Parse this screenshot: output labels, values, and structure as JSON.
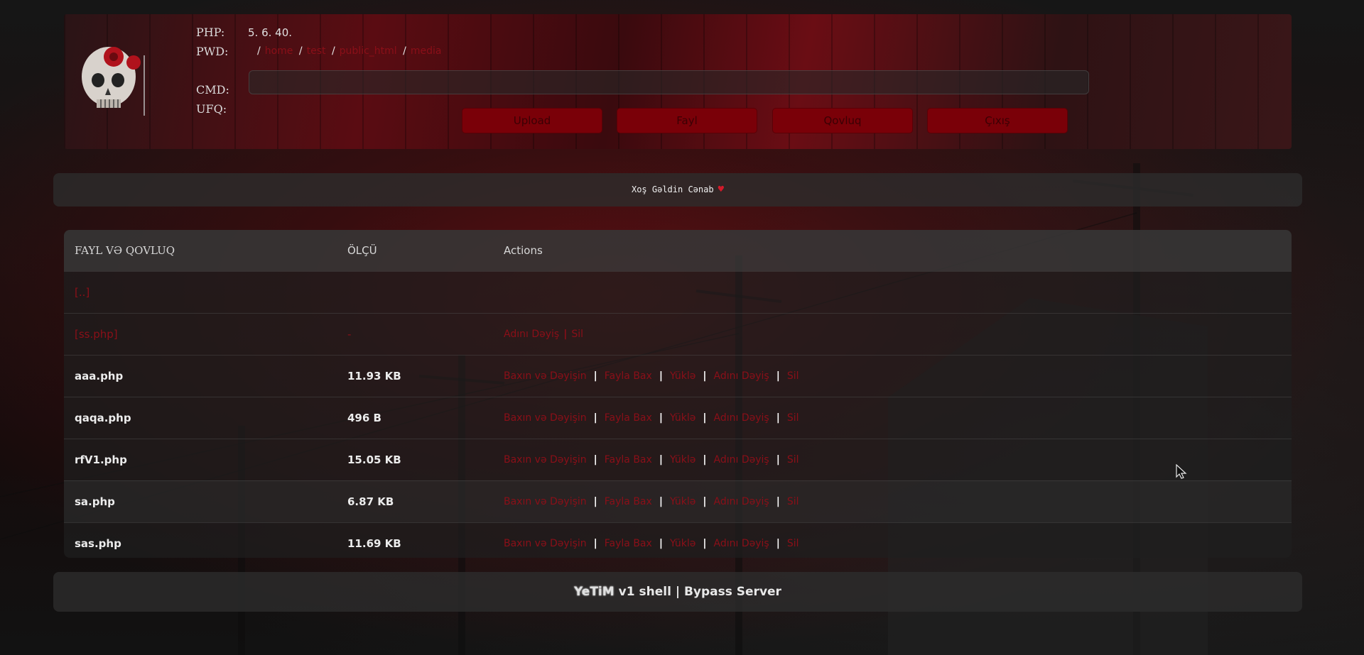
{
  "header": {
    "labels": {
      "php": "PHP:",
      "pwd": "PWD:",
      "cmd": "CMD:",
      "ufq": "UFQ:"
    },
    "php_version": "5. 6. 40.",
    "pwd_path": [
      "home",
      "test",
      "public_html",
      "media"
    ],
    "cmd_value": "",
    "buttons": {
      "upload": "Upload",
      "fayl": "Fayl",
      "qovluq": "Qovluq",
      "cixis": "Çıxış"
    }
  },
  "welcome": {
    "text": "Xoş Gəldin Cənab",
    "icon": "heart-icon"
  },
  "table": {
    "headers": {
      "name": "FAYL VƏ QOVLUQ",
      "size": "ÖLÇÜ",
      "actions": "Actions"
    },
    "parent_row": {
      "name": "[..]"
    },
    "dir_row": {
      "name": "[ss.php]",
      "size": "-",
      "actions": [
        "Adını Dəyiş",
        "Sil"
      ]
    },
    "files": [
      {
        "name": "aaa.php",
        "size": "11.93 KB"
      },
      {
        "name": "qaqa.php",
        "size": "496 B"
      },
      {
        "name": "rfV1.php",
        "size": "15.05 KB"
      },
      {
        "name": "sa.php",
        "size": "6.87 KB"
      },
      {
        "name": "sas.php",
        "size": "11.69 KB"
      }
    ],
    "file_actions": [
      "Baxın və Dəyişin",
      "Fayla Bax",
      "Yüklə",
      "Adını Dəyiş",
      "Sil"
    ]
  },
  "footer": {
    "brand": "YeTiM",
    "text": "v1 shell | Bypass Server"
  },
  "colors": {
    "accent_red": "#8b0f18",
    "button_red": "#7a0008"
  }
}
